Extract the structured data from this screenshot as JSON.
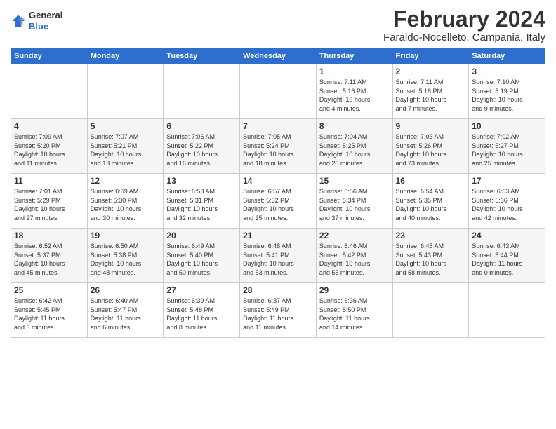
{
  "header": {
    "logo_general": "General",
    "logo_blue": "Blue",
    "main_title": "February 2024",
    "subtitle": "Faraldo-Nocelleto, Campania, Italy"
  },
  "columns": [
    "Sunday",
    "Monday",
    "Tuesday",
    "Wednesday",
    "Thursday",
    "Friday",
    "Saturday"
  ],
  "weeks": [
    [
      {
        "day": "",
        "info": ""
      },
      {
        "day": "",
        "info": ""
      },
      {
        "day": "",
        "info": ""
      },
      {
        "day": "",
        "info": ""
      },
      {
        "day": "1",
        "info": "Sunrise: 7:11 AM\nSunset: 5:16 PM\nDaylight: 10 hours\nand 4 minutes."
      },
      {
        "day": "2",
        "info": "Sunrise: 7:11 AM\nSunset: 5:18 PM\nDaylight: 10 hours\nand 7 minutes."
      },
      {
        "day": "3",
        "info": "Sunrise: 7:10 AM\nSunset: 5:19 PM\nDaylight: 10 hours\nand 9 minutes."
      }
    ],
    [
      {
        "day": "4",
        "info": "Sunrise: 7:09 AM\nSunset: 5:20 PM\nDaylight: 10 hours\nand 11 minutes."
      },
      {
        "day": "5",
        "info": "Sunrise: 7:07 AM\nSunset: 5:21 PM\nDaylight: 10 hours\nand 13 minutes."
      },
      {
        "day": "6",
        "info": "Sunrise: 7:06 AM\nSunset: 5:22 PM\nDaylight: 10 hours\nand 16 minutes."
      },
      {
        "day": "7",
        "info": "Sunrise: 7:05 AM\nSunset: 5:24 PM\nDaylight: 10 hours\nand 18 minutes."
      },
      {
        "day": "8",
        "info": "Sunrise: 7:04 AM\nSunset: 5:25 PM\nDaylight: 10 hours\nand 20 minutes."
      },
      {
        "day": "9",
        "info": "Sunrise: 7:03 AM\nSunset: 5:26 PM\nDaylight: 10 hours\nand 23 minutes."
      },
      {
        "day": "10",
        "info": "Sunrise: 7:02 AM\nSunset: 5:27 PM\nDaylight: 10 hours\nand 25 minutes."
      }
    ],
    [
      {
        "day": "11",
        "info": "Sunrise: 7:01 AM\nSunset: 5:29 PM\nDaylight: 10 hours\nand 27 minutes."
      },
      {
        "day": "12",
        "info": "Sunrise: 6:59 AM\nSunset: 5:30 PM\nDaylight: 10 hours\nand 30 minutes."
      },
      {
        "day": "13",
        "info": "Sunrise: 6:58 AM\nSunset: 5:31 PM\nDaylight: 10 hours\nand 32 minutes."
      },
      {
        "day": "14",
        "info": "Sunrise: 6:57 AM\nSunset: 5:32 PM\nDaylight: 10 hours\nand 35 minutes."
      },
      {
        "day": "15",
        "info": "Sunrise: 6:56 AM\nSunset: 5:34 PM\nDaylight: 10 hours\nand 37 minutes."
      },
      {
        "day": "16",
        "info": "Sunrise: 6:54 AM\nSunset: 5:35 PM\nDaylight: 10 hours\nand 40 minutes."
      },
      {
        "day": "17",
        "info": "Sunrise: 6:53 AM\nSunset: 5:36 PM\nDaylight: 10 hours\nand 42 minutes."
      }
    ],
    [
      {
        "day": "18",
        "info": "Sunrise: 6:52 AM\nSunset: 5:37 PM\nDaylight: 10 hours\nand 45 minutes."
      },
      {
        "day": "19",
        "info": "Sunrise: 6:50 AM\nSunset: 5:38 PM\nDaylight: 10 hours\nand 48 minutes."
      },
      {
        "day": "20",
        "info": "Sunrise: 6:49 AM\nSunset: 5:40 PM\nDaylight: 10 hours\nand 50 minutes."
      },
      {
        "day": "21",
        "info": "Sunrise: 6:48 AM\nSunset: 5:41 PM\nDaylight: 10 hours\nand 53 minutes."
      },
      {
        "day": "22",
        "info": "Sunrise: 6:46 AM\nSunset: 5:42 PM\nDaylight: 10 hours\nand 55 minutes."
      },
      {
        "day": "23",
        "info": "Sunrise: 6:45 AM\nSunset: 5:43 PM\nDaylight: 10 hours\nand 58 minutes."
      },
      {
        "day": "24",
        "info": "Sunrise: 6:43 AM\nSunset: 5:44 PM\nDaylight: 11 hours\nand 0 minutes."
      }
    ],
    [
      {
        "day": "25",
        "info": "Sunrise: 6:42 AM\nSunset: 5:45 PM\nDaylight: 11 hours\nand 3 minutes."
      },
      {
        "day": "26",
        "info": "Sunrise: 6:40 AM\nSunset: 5:47 PM\nDaylight: 11 hours\nand 6 minutes."
      },
      {
        "day": "27",
        "info": "Sunrise: 6:39 AM\nSunset: 5:48 PM\nDaylight: 11 hours\nand 8 minutes."
      },
      {
        "day": "28",
        "info": "Sunrise: 6:37 AM\nSunset: 5:49 PM\nDaylight: 11 hours\nand 11 minutes."
      },
      {
        "day": "29",
        "info": "Sunrise: 6:36 AM\nSunset: 5:50 PM\nDaylight: 11 hours\nand 14 minutes."
      },
      {
        "day": "",
        "info": ""
      },
      {
        "day": "",
        "info": ""
      }
    ]
  ]
}
